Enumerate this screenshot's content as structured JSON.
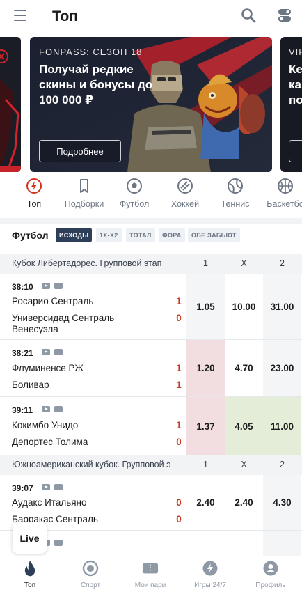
{
  "header": {
    "title": "Топ"
  },
  "banners": {
    "main": {
      "eyebrow": "FONPASS: СЕЗОН 18",
      "headline": "Получай редкие скины и бонусы до 100 000 ₽",
      "button": "Подробнее"
    },
    "right": {
      "eyebrow": "VIP",
      "headline": "Ке ка по"
    }
  },
  "sport_tabs": [
    {
      "label": "Топ",
      "icon": "fire-icon",
      "active": true
    },
    {
      "label": "Подборки",
      "icon": "bookmark-icon",
      "active": false
    },
    {
      "label": "Футбол",
      "icon": "football-icon",
      "active": false
    },
    {
      "label": "Хоккей",
      "icon": "hockey-puck-icon",
      "active": false
    },
    {
      "label": "Теннис",
      "icon": "tennis-icon",
      "active": false
    },
    {
      "label": "Баскетбо",
      "icon": "basketball-icon",
      "active": false
    }
  ],
  "market": {
    "title": "Футбол",
    "chips": [
      "ИСХОДЫ",
      "1Х-Х2",
      "ТОТАЛ",
      "ФОРА",
      "ОБЕ ЗАБЬЮТ"
    ],
    "active_chip": "ИСХОДЫ"
  },
  "leagues": [
    {
      "name": "Кубок Либертадорес. Групповой этап",
      "cols": [
        "1",
        "X",
        "2"
      ],
      "matches": [
        {
          "time": "38:10",
          "team1": "Росарио Сентраль",
          "team2": "Универсидад Сентраль Венесуэла",
          "score1": "1",
          "score2": "0",
          "odds": [
            "1.05",
            "10.00",
            "31.00"
          ],
          "trend": [
            "",
            "",
            ""
          ]
        },
        {
          "time": "38:21",
          "team1": "Флуминенсе РЖ",
          "team2": "Боливар",
          "score1": "1",
          "score2": "1",
          "odds": [
            "1.20",
            "4.70",
            "23.00"
          ],
          "trend": [
            "down",
            "",
            ""
          ]
        },
        {
          "time": "39:11",
          "team1": "Кокимбо Унидо",
          "team2": "Депортес Толима",
          "score1": "1",
          "score2": "0",
          "odds": [
            "1.37",
            "4.05",
            "11.00"
          ],
          "trend": [
            "down",
            "up",
            "up"
          ]
        }
      ]
    },
    {
      "name": "Южноамериканский кубок. Групповой э",
      "cols": [
        "1",
        "X",
        "2"
      ],
      "matches": [
        {
          "time": "39:07",
          "team1": "Аудакс Итальяно",
          "team2": "Барракас Сентраль",
          "score1": "0",
          "score2": "0",
          "odds": [
            "2.40",
            "2.40",
            "4.30"
          ],
          "trend": [
            "",
            "",
            ""
          ]
        }
      ]
    }
  ],
  "live_button": "Live",
  "bottom_nav": [
    {
      "label": "Топ",
      "icon": "flame-icon",
      "active": true
    },
    {
      "label": "Спорт",
      "icon": "target-icon",
      "active": false
    },
    {
      "label": "Мои пари",
      "icon": "ticket-icon",
      "active": false
    },
    {
      "label": "Игры 24/7",
      "icon": "lightning-icon",
      "active": false
    },
    {
      "label": "Профиль",
      "icon": "profile-icon",
      "active": false
    }
  ],
  "colors": {
    "accent": "#d3321b",
    "navy": "#2d3e58",
    "score": "#c8391f",
    "odd_down": "#f2dde1",
    "odd_up": "#e4edd8"
  }
}
